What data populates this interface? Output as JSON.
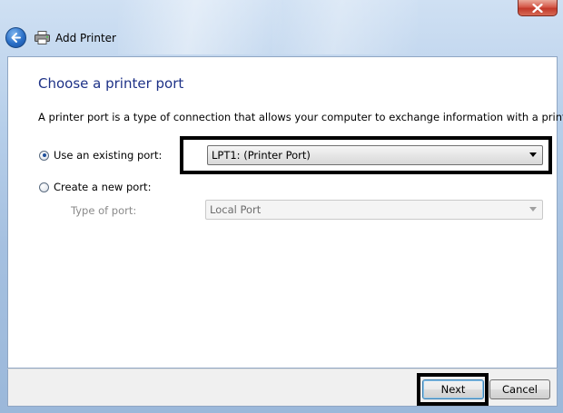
{
  "window": {
    "title": "Add Printer"
  },
  "page": {
    "heading": "Choose a printer port",
    "description": "A printer port is a type of connection that allows your computer to exchange information with a printer."
  },
  "options": {
    "existing_port": {
      "label": "Use an existing port:",
      "selected": true,
      "value": "LPT1: (Printer Port)"
    },
    "new_port": {
      "label": "Create a new port:",
      "selected": false,
      "type_label": "Type of port:",
      "type_value": "Local Port"
    }
  },
  "buttons": {
    "next": "Next",
    "cancel": "Cancel"
  },
  "icons": {
    "back": "back-arrow-icon",
    "printer": "printer-icon",
    "close": "close-icon"
  },
  "colors": {
    "heading": "#1e3287",
    "close_button": "#c2392a",
    "frame": "#b7cfea"
  }
}
